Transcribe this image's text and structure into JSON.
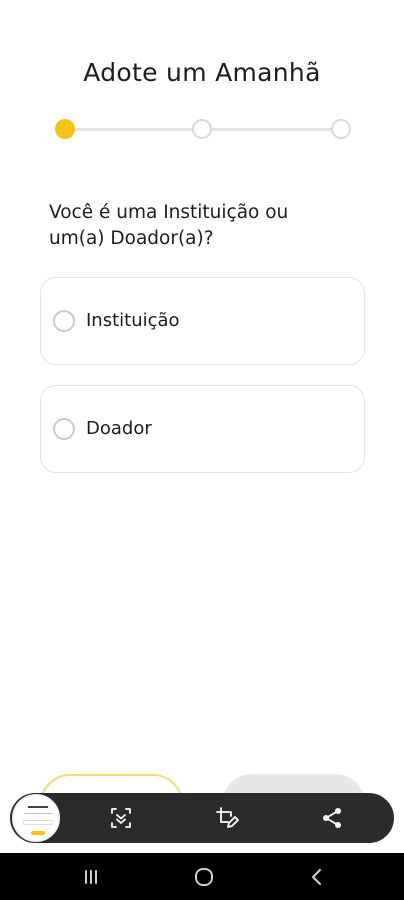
{
  "header": {
    "title": "Adote um Amanhã"
  },
  "stepper": {
    "total_steps": 3,
    "current_step": 1
  },
  "question": {
    "text": "Você é uma Instituição ou um(a) Doador(a)?"
  },
  "options": [
    {
      "label": "Instituição",
      "selected": false
    },
    {
      "label": "Doador",
      "selected": false
    }
  ],
  "colors": {
    "accent": "#f6c21a",
    "border": "#e3e3e3",
    "capture_bar": "#2b2b2b"
  },
  "capture_toolbar": {
    "tools": [
      "scroll-capture-icon",
      "crop-edit-icon",
      "share-icon"
    ]
  },
  "system_nav": {
    "buttons": [
      "recent-apps-icon",
      "home-icon",
      "back-icon"
    ]
  }
}
